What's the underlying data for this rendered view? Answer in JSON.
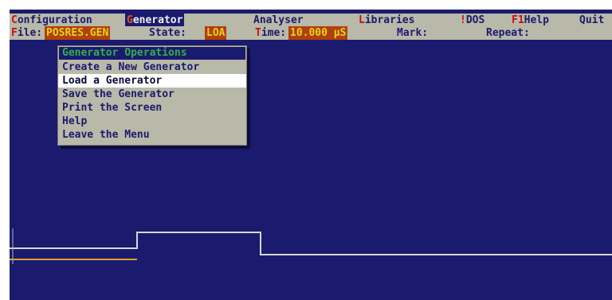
{
  "menubar": {
    "items": [
      {
        "label": "Configuration"
      },
      {
        "label": "Generator"
      },
      {
        "label": "Analyser"
      },
      {
        "label": "Libraries"
      },
      {
        "label": "!DOS"
      },
      {
        "label": "F1Help"
      },
      {
        "label": "Quit"
      }
    ]
  },
  "status": {
    "file_label": "File:",
    "file_value": "POSRES.GEN",
    "state_label": "State:",
    "state_value": "LOA",
    "time_label": "Time:",
    "time_value": "10.000 µS",
    "mark_label": "Mark:",
    "repeat_label": "Repeat:"
  },
  "menu": {
    "title": "Generator Operations",
    "items": [
      {
        "label": "Create a New Generator"
      },
      {
        "label": "Load a Generator"
      },
      {
        "label": "Save the Generator"
      },
      {
        "label": "Print the Screen"
      },
      {
        "label": "Help"
      },
      {
        "label": "Leave the Menu"
      }
    ],
    "selected_index": 1
  },
  "colors": {
    "background": "#1a1a6e",
    "bar": "#b9b9a9",
    "hotkey": "#c81010",
    "waveform": "#d8d8d8",
    "marker": "#e0a020"
  }
}
